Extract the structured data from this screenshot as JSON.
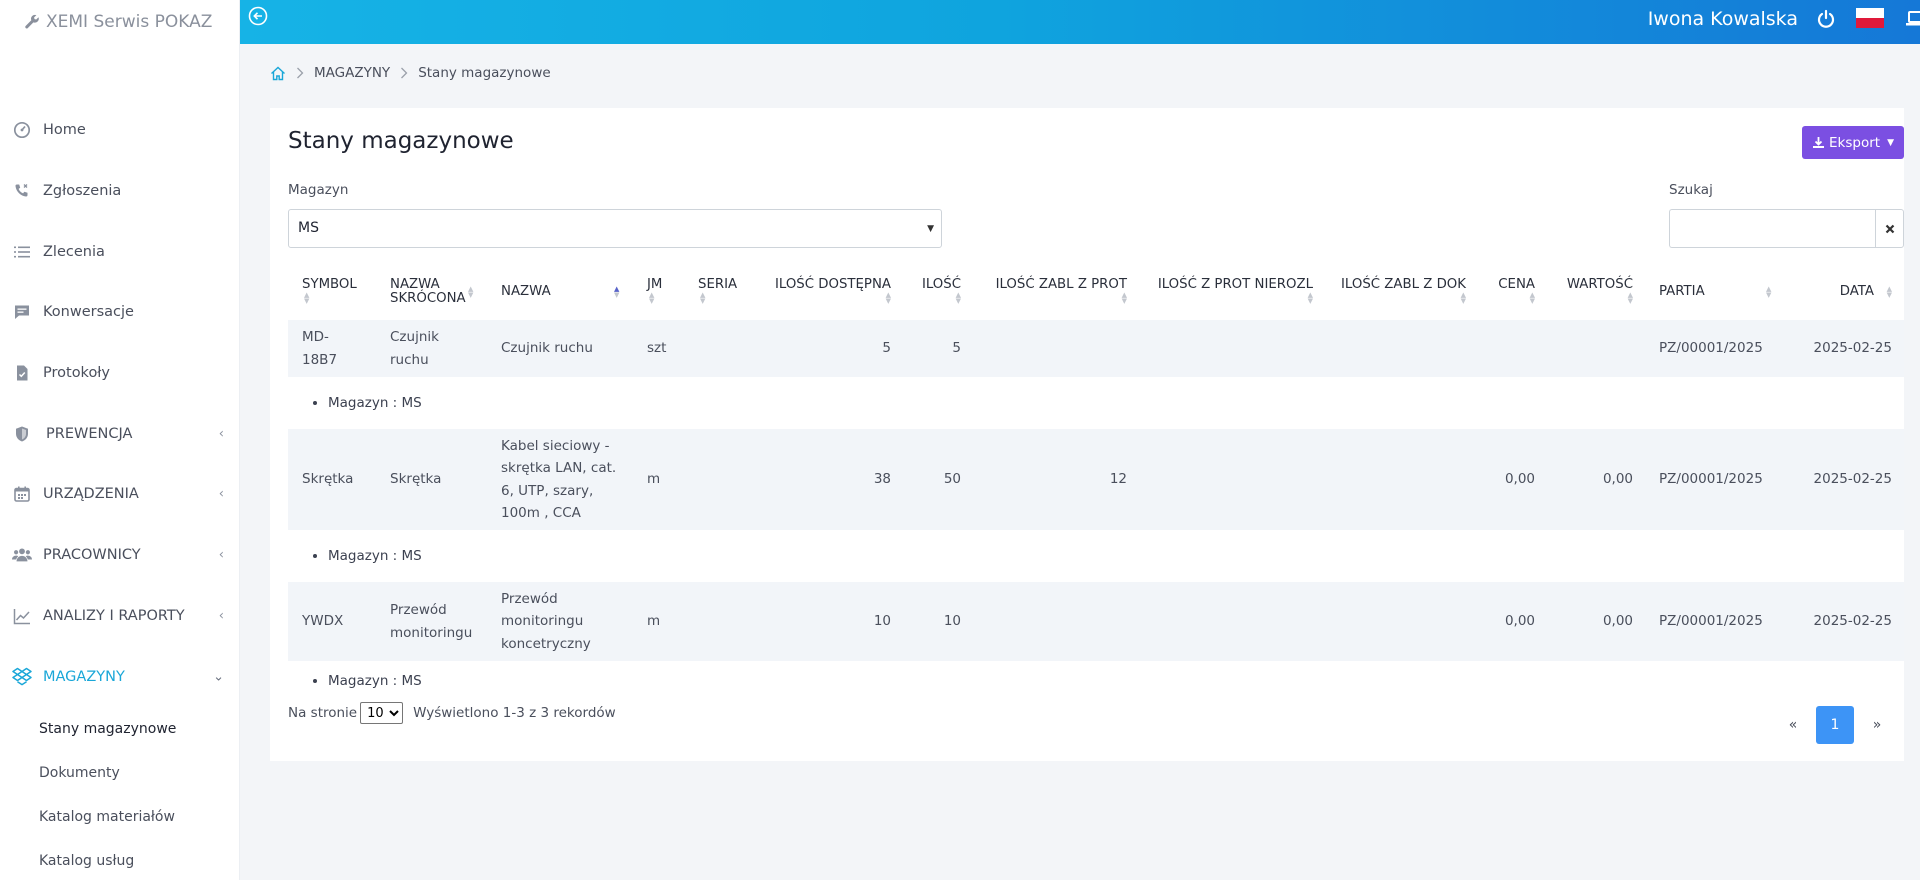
{
  "app": {
    "brand": "XEMI Serwis POKAZ"
  },
  "topbar": {
    "user_name": "Iwona Kowalska"
  },
  "sidebar": {
    "items": [
      {
        "label": "Home",
        "icon": "dashboard-icon"
      },
      {
        "label": "Zgłoszenia",
        "icon": "phone-icon"
      },
      {
        "label": "Zlecenia",
        "icon": "list-icon"
      },
      {
        "label": "Konwersacje",
        "icon": "chat-icon"
      },
      {
        "label": "Protokoły",
        "icon": "document-icon"
      },
      {
        "label": "PREWENCJA",
        "icon": "shield-icon"
      },
      {
        "label": "URZĄDZENIA",
        "icon": "calendar-icon"
      },
      {
        "label": "PRACOWNICY",
        "icon": "users-icon"
      },
      {
        "label": "ANALIZY I RAPORTY",
        "icon": "chart-line-icon"
      },
      {
        "label": "MAGAZYNY",
        "icon": "dropbox-icon"
      }
    ],
    "subitems": [
      {
        "label": "Stany magazynowe"
      },
      {
        "label": "Dokumenty"
      },
      {
        "label": "Katalog materiałów"
      },
      {
        "label": "Katalog usług"
      }
    ],
    "accent_color": "#1aa7d8"
  },
  "breadcrumb": {
    "items": [
      "MAGAZYNY",
      "Stany magazynowe"
    ]
  },
  "page": {
    "title": "Stany magazynowe",
    "export_label": "Eksport",
    "warehouse_label": "Magazyn",
    "warehouse_value": "MS",
    "search_label": "Szukaj",
    "search_value": ""
  },
  "table": {
    "columns": [
      {
        "label": "SYMBOL"
      },
      {
        "label": "NAZWA SKRÓCONA"
      },
      {
        "label": "NAZWA"
      },
      {
        "label": "JM"
      },
      {
        "label": "SERIA"
      },
      {
        "label": "ILOŚĆ DOSTĘPNA"
      },
      {
        "label": "ILOŚĆ"
      },
      {
        "label": "ILOŚĆ ZABL Z PROT"
      },
      {
        "label": "ILOŚĆ Z PROT NIEROZL"
      },
      {
        "label": "ILOŚĆ ZABL Z DOK"
      },
      {
        "label": "CENA"
      },
      {
        "label": "WARTOŚĆ"
      },
      {
        "label": "PARTIA"
      },
      {
        "label": "DATA"
      }
    ],
    "rows": [
      {
        "symbol": "MD-18B7",
        "short_name": "Czujnik ruchu",
        "name": "Czujnik ruchu",
        "unit": "szt",
        "series": "",
        "qty_available": "5",
        "qty": "5",
        "qty_blocked_prot": "",
        "qty_prot_unsettled": "",
        "qty_blocked_doc": "",
        "price": "",
        "value": "",
        "batch": "PZ/00001/2025",
        "date": "2025-02-25",
        "detail": "Magazyn : MS"
      },
      {
        "symbol": "Skrętka",
        "short_name": "Skrętka",
        "name": "Kabel sieciowy - skrętka LAN, cat. 6, UTP, szary, 100m , CCA",
        "unit": "m",
        "series": "",
        "qty_available": "38",
        "qty": "50",
        "qty_blocked_prot": "12",
        "qty_prot_unsettled": "",
        "qty_blocked_doc": "",
        "price": "0,00",
        "value": "0,00",
        "batch": "PZ/00001/2025",
        "date": "2025-02-25",
        "detail": "Magazyn : MS"
      },
      {
        "symbol": "YWDX",
        "short_name": "Przewód monitoringu",
        "name": "Przewód monitoringu koncetryczny",
        "unit": "m",
        "series": "",
        "qty_available": "10",
        "qty": "10",
        "qty_blocked_prot": "",
        "qty_prot_unsettled": "",
        "qty_blocked_doc": "",
        "price": "0,00",
        "value": "0,00",
        "batch": "PZ/00001/2025",
        "date": "2025-02-25",
        "detail": "Magazyn : MS"
      }
    ]
  },
  "footer": {
    "per_page_label": "Na stronie",
    "per_page_value": "10",
    "records_text": "Wyświetlono 1-3 z 3 rekordów",
    "pager": {
      "prev": "«",
      "current": "1",
      "next": "»"
    }
  },
  "colors": {
    "topbar_gradient_start": "#16b3e6",
    "topbar_gradient_end": "#1578d7",
    "export_button": "#7b4fe2",
    "pager_active": "#3d94f6",
    "row_shade": "#f2f5f9"
  }
}
